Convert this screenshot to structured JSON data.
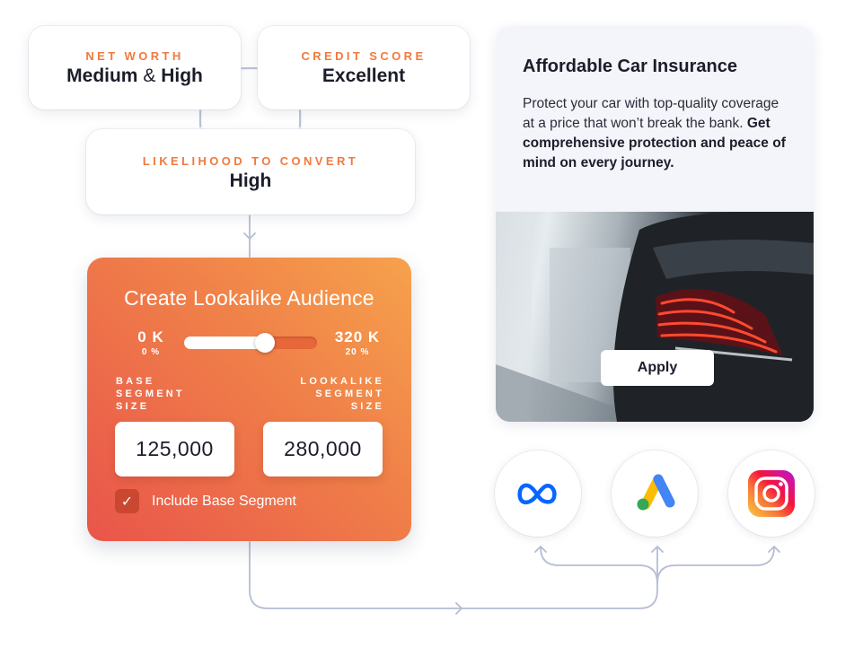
{
  "attributes": {
    "net_worth": {
      "label": "NET WORTH",
      "value_a": "Medium",
      "value_amp": "&",
      "value_b": "High"
    },
    "credit_score": {
      "label": "CREDIT SCORE",
      "value": "Excellent"
    },
    "likelihood": {
      "label": "LIKELIHOOD TO CONVERT",
      "value": "High"
    }
  },
  "lookalike": {
    "title": "Create Lookalike Audience",
    "range_min": {
      "value": "0 K",
      "percent": "0 %"
    },
    "range_max": {
      "value": "320 K",
      "percent": "20 %"
    },
    "slider_fraction": 0.61,
    "base_label": [
      "BASE",
      "SEGMENT",
      "SIZE"
    ],
    "lookalike_label": [
      "LOOKALIKE",
      "SEGMENT",
      "SIZE"
    ],
    "base_size": "125,000",
    "lookalike_size": "280,000",
    "include_base": {
      "checked": true,
      "check_glyph": "✓",
      "label": "Include Base Segment"
    }
  },
  "ad": {
    "title": "Affordable Car Insurance",
    "body_regular": "Protect your car with top-quality coverage at a price that won’t break the bank. ",
    "body_bold": "Get comprehensive protection and peace of mind on every journey.",
    "image_alt": "car-taillight-photo",
    "cta": "Apply"
  },
  "platforms": [
    {
      "name": "Meta",
      "icon": "meta-icon",
      "color": "#0866ff"
    },
    {
      "name": "Google Ads",
      "icon": "google-ads-icon",
      "colors": [
        "#fbbc04",
        "#4285f4",
        "#34a853"
      ]
    },
    {
      "name": "Instagram",
      "icon": "instagram-icon",
      "colors": [
        "#fcca3f",
        "#f5133d",
        "#b915d8"
      ]
    }
  ],
  "colors": {
    "accent": "#f07a3e",
    "connector": "#b5bdd3",
    "text": "#1b1d2a"
  }
}
